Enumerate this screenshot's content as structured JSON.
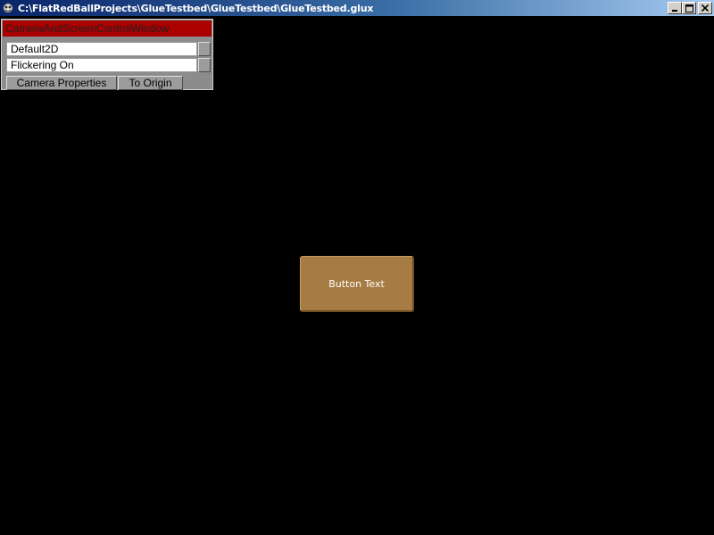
{
  "window": {
    "title": "C:\\FlatRedBallProjects\\GlueTestbed\\GlueTestbed\\GlueTestbed.glux",
    "icon": "app-icon",
    "controls": {
      "minimize_icon": "minimize-icon",
      "maximize_icon": "maximize-icon",
      "close_icon": "close-icon"
    }
  },
  "camera_window": {
    "title": "CameraAndScreenControlWindow",
    "camera_mode": "Default2D",
    "flicker_mode": "Flickering On",
    "camera_properties_label": "Camera Properties",
    "to_origin_label": "To Origin"
  },
  "center_button": {
    "label": "Button Text"
  },
  "colors": {
    "background": "#000000",
    "header_red": "#aa0000",
    "panel_gray": "#8c8c8c",
    "button_tan": "#a67c44"
  }
}
